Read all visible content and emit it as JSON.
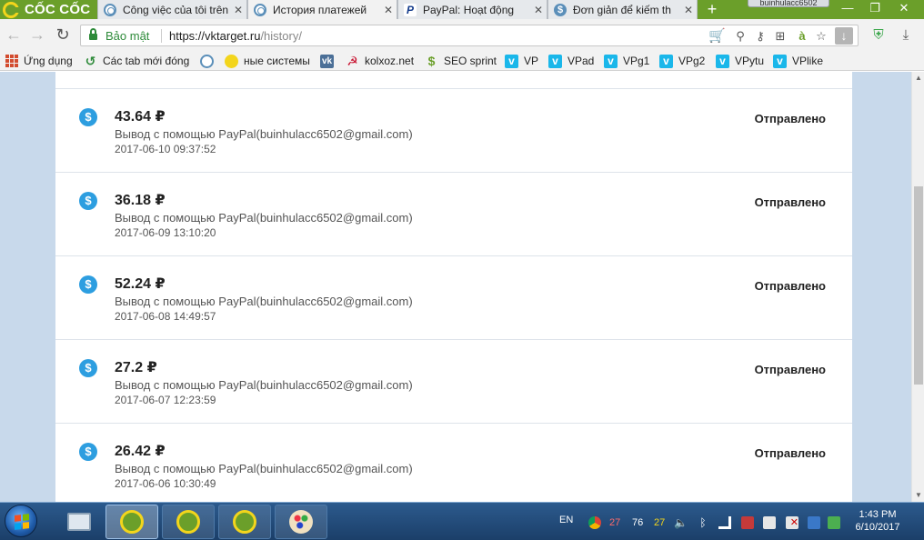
{
  "browser": {
    "brand": "CỐC CỐC",
    "tabs": [
      {
        "title": "Công việc của tôi trên",
        "favicon": "ring-icon"
      },
      {
        "title": "История платежей",
        "favicon": "ring-icon",
        "active": true
      },
      {
        "title": "PayPal: Hoạt động",
        "favicon": "paypal-icon"
      },
      {
        "title": "Đơn giản để kiếm th",
        "favicon": "seo-icon"
      }
    ],
    "profile": "buinhulacc6502",
    "address": {
      "secure_label": "Bảo mật",
      "url_base": "https://vktarget.ru",
      "url_path": "/history/"
    },
    "bookmarks": [
      {
        "label": "Ứng dụng",
        "icon": "apps-icon"
      },
      {
        "label": "Các tab mới đóng",
        "icon": "history-icon"
      },
      {
        "label": "",
        "icon": "ring-icon"
      },
      {
        "label": "ные системы",
        "icon": "sun-icon"
      },
      {
        "label": "",
        "icon": "vk-icon"
      },
      {
        "label": "kolxoz.net",
        "icon": "hammer-sickle-icon"
      },
      {
        "label": "SEO sprint",
        "icon": "seo-sprint-icon"
      },
      {
        "label": "VP",
        "icon": "vimeo-icon"
      },
      {
        "label": "VPad",
        "icon": "vimeo-icon"
      },
      {
        "label": "VPg1",
        "icon": "vimeo-icon"
      },
      {
        "label": "VPg2",
        "icon": "vimeo-icon"
      },
      {
        "label": "VPytu",
        "icon": "vimeo-icon"
      },
      {
        "label": "VPlike",
        "icon": "vimeo-icon"
      }
    ]
  },
  "payments": [
    {
      "amount": "43.64 ₽",
      "description": "Вывод с помощью PayPal(buinhulacc6502@gmail.com)",
      "date": "2017-06-10 09:37:52",
      "status": "Отправлено"
    },
    {
      "amount": "36.18 ₽",
      "description": "Вывод с помощью PayPal(buinhulacc6502@gmail.com)",
      "date": "2017-06-09 13:10:20",
      "status": "Отправлено"
    },
    {
      "amount": "52.24 ₽",
      "description": "Вывод с помощью PayPal(buinhulacc6502@gmail.com)",
      "date": "2017-06-08 14:49:57",
      "status": "Отправлено"
    },
    {
      "amount": "27.2 ₽",
      "description": "Вывод с помощью PayPal(buinhulacc6502@gmail.com)",
      "date": "2017-06-07 12:23:59",
      "status": "Отправлено"
    },
    {
      "amount": "26.42 ₽",
      "description": "Вывод с помощью PayPal(buinhulacc6502@gmail.com)",
      "date": "2017-06-06 10:30:49",
      "status": "Отправлено"
    }
  ],
  "taskbar": {
    "language": "EN",
    "tray_numbers": [
      "27",
      "76",
      "27"
    ],
    "time": "1:43 PM",
    "date": "6/10/2017"
  },
  "colors": {
    "tabstrip": "#6b9f2a",
    "accent_blue": "#2d9ee0",
    "page_bg": "#c8d9eb",
    "secure_green": "#2e8b3a"
  }
}
